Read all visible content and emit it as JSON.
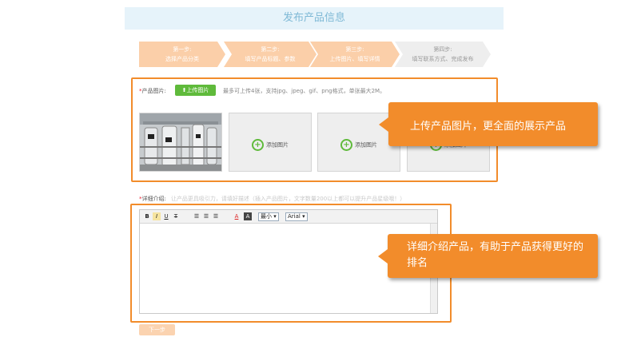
{
  "header": {
    "title": "发布产品信息"
  },
  "steps": [
    {
      "name": "第一步:",
      "desc": "选择产品分类",
      "done": true
    },
    {
      "name": "第二步:",
      "desc": "填写产品标题、参数",
      "done": true
    },
    {
      "name": "第三步:",
      "desc": "上传图片、填写详情",
      "done": true
    },
    {
      "name": "第四步:",
      "desc": "填写联系方式、完成发布",
      "done": false
    }
  ],
  "photo": {
    "required_mark": "*",
    "label": "产品图片:",
    "upload_label": "上传图片",
    "hint": "最多可上传4张，支持jpg、jpeg、gif、png格式，单张最大2M。",
    "add_label": "添加图片"
  },
  "detail": {
    "required_mark": "*",
    "label": "详细介绍:",
    "hint": "让产品更具吸引力，请填好描述（插入产品图片，文字数量200以上都可以提升产品星级哦！）"
  },
  "editor": {
    "bold": "B",
    "italic": "I",
    "underline": "U",
    "strike": "T",
    "font_color": "A",
    "bg_color": "A",
    "size_value": "最小",
    "font_value": "Arial"
  },
  "next_label": "下一步",
  "callouts": {
    "photo": "上传产品图片，更全面的展示产品",
    "detail": "详细介绍产品，有助于产品获得更好的排名"
  },
  "colors": {
    "accent": "#f28c2b",
    "step_done": "#fbcfa9",
    "step_todo": "#eeeeee",
    "upload": "#5fba3b"
  }
}
